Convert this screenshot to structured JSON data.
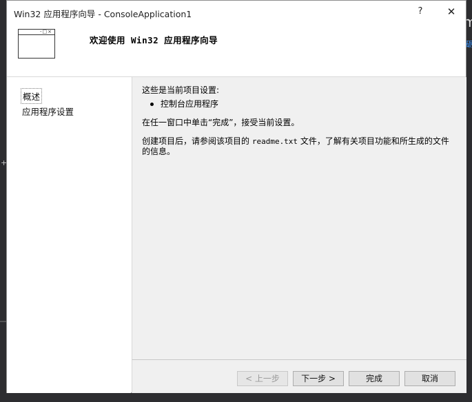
{
  "window": {
    "title": "Win32 应用程序向导 - ConsoleApplication1",
    "help_label": "?",
    "close_label": "✕"
  },
  "header": {
    "title": "欢迎使用 Win32 应用程序向导",
    "icon": "window-icon",
    "icon_controls": "-□×"
  },
  "nav": {
    "items": [
      {
        "label": "概述",
        "active": true
      },
      {
        "label": "应用程序设置",
        "active": false
      }
    ]
  },
  "content": {
    "intro": "这些是当前项目设置:",
    "bullet": "控制台应用程序",
    "finish_hint": "在任一窗口中单击“完成”，接受当前设置。",
    "readme_before": "创建项目后，请参阅该项目的 ",
    "readme_file": "readme.txt",
    "readme_after": " 文件，了解有关项目功能和所生成的文件的信息。"
  },
  "buttons": {
    "prev": "< 上一步",
    "next": "下一步 >",
    "finish": "完成",
    "cancel": "取消"
  },
  "background": {
    "right_glyph": "m",
    "right_blue": "砺",
    "left_plus": "+"
  }
}
